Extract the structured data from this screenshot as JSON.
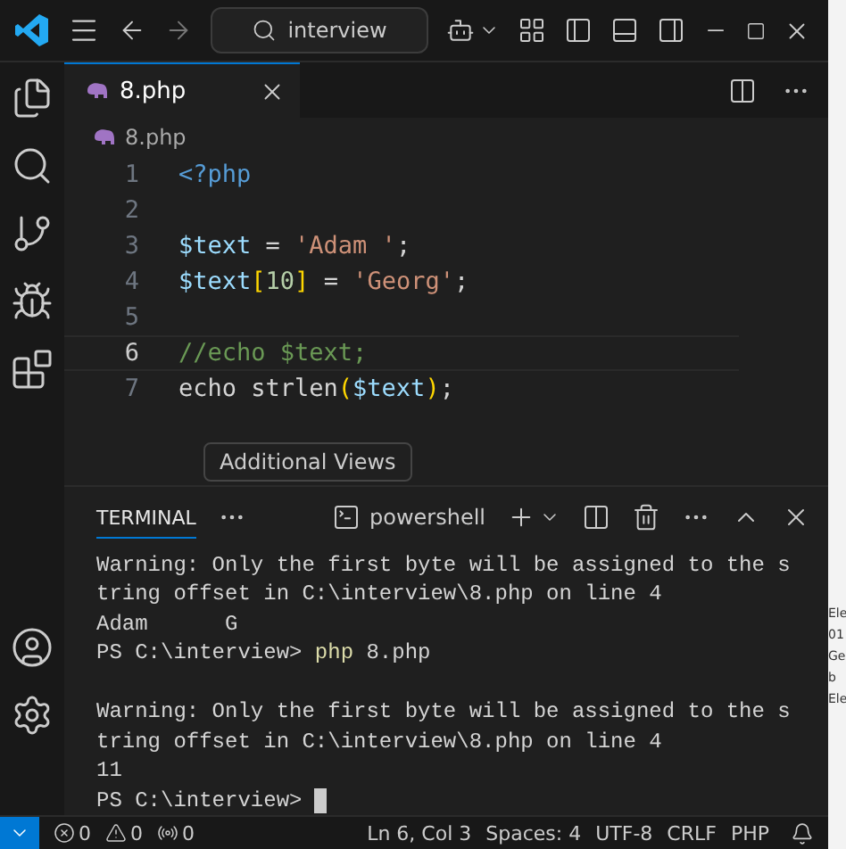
{
  "titlebar": {
    "search": "interview"
  },
  "tabs": [
    {
      "label": "8.php",
      "selected": true
    }
  ],
  "breadcrumb": "8.php",
  "code": [
    {
      "number": "1",
      "current": false,
      "tokens": [
        {
          "text": "<?php",
          "kind": "tag"
        }
      ]
    },
    {
      "number": "2",
      "current": false
    },
    {
      "number": "3",
      "current": false,
      "tokens": [
        {
          "text": "$text",
          "kind": "var"
        },
        {
          "text": " = ",
          "kind": "plain"
        },
        {
          "text": "'Adam '",
          "kind": "string"
        },
        {
          "text": ";",
          "kind": "plain"
        }
      ]
    },
    {
      "number": "4",
      "current": false,
      "tokens": [
        {
          "text": "$text",
          "kind": "var"
        },
        {
          "text": "[",
          "kind": "bracket"
        },
        {
          "text": "10",
          "kind": "number"
        },
        {
          "text": "]",
          "kind": "bracket"
        },
        {
          "text": " = ",
          "kind": "plain"
        },
        {
          "text": "'Georg'",
          "kind": "string"
        },
        {
          "text": ";",
          "kind": "plain"
        }
      ]
    },
    {
      "number": "5",
      "current": false
    },
    {
      "number": "6",
      "current": true,
      "tokens": [
        {
          "text": "//echo $text;",
          "kind": "comment"
        }
      ]
    },
    {
      "number": "7",
      "current": false,
      "tokens": [
        {
          "text": "echo strlen",
          "kind": "plain"
        },
        {
          "text": "(",
          "kind": "bracket"
        },
        {
          "text": "$text",
          "kind": "var"
        },
        {
          "text": ")",
          "kind": "bracket"
        },
        {
          "text": ";",
          "kind": "plain"
        }
      ]
    }
  ],
  "tooltip": "Additional Views",
  "terminal": {
    "tab": "TERMINAL",
    "shell": "powershell",
    "lines": [
      {
        "parts": [
          {
            "text": "Warning: Only the first byte will be assigned to the s",
            "kind": "plain"
          }
        ]
      },
      {
        "parts": [
          {
            "text": "tring offset in C:\\interview\\8.php on line 4",
            "kind": "plain"
          }
        ]
      },
      {
        "parts": [
          {
            "text": "Adam      G",
            "kind": "plain"
          }
        ]
      },
      {
        "parts": [
          {
            "text": "PS C:\\interview> ",
            "kind": "plain"
          },
          {
            "text": "php",
            "kind": "command"
          },
          {
            "text": " 8.php",
            "kind": "plain"
          }
        ]
      },
      {
        "blank": true
      },
      {
        "parts": [
          {
            "text": "Warning: Only the first byte will be assigned to the s",
            "kind": "plain"
          }
        ]
      },
      {
        "parts": [
          {
            "text": "tring offset in C:\\interview\\8.php on line 4",
            "kind": "plain"
          }
        ]
      },
      {
        "parts": [
          {
            "text": "11",
            "kind": "plain"
          }
        ]
      },
      {
        "parts": [
          {
            "text": "PS C:\\interview> ",
            "kind": "plain"
          }
        ],
        "cursor": true
      }
    ]
  },
  "status": {
    "errors": "0",
    "warnings": "0",
    "ports": "0",
    "items": [
      "Ln 6, Col 3",
      "Spaces: 4",
      "UTF-8",
      "CRLF",
      "PHP"
    ]
  },
  "side_window": [
    "Ele",
    "01",
    "Ge",
    "b",
    "Ele"
  ]
}
